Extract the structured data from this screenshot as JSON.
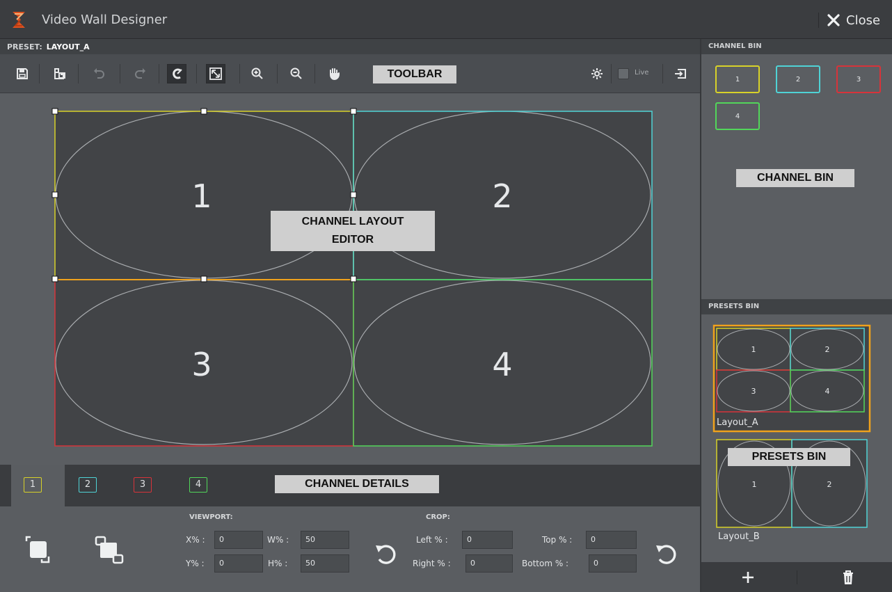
{
  "titlebar": {
    "title": "Video Wall Designer",
    "close_label": "Close"
  },
  "preset": {
    "label": "PRESET:",
    "value": "LAYOUT_A"
  },
  "toolbar": {
    "callout": "TOOLBAR",
    "live_label": "Live",
    "icons": [
      "save-icon",
      "save-as-icon",
      "undo-icon",
      "redo-icon",
      "snap-icon",
      "fit-icon",
      "zoom-in-icon",
      "zoom-out-icon",
      "pan-icon",
      "settings-icon",
      "live-checkbox",
      "export-icon"
    ]
  },
  "editor": {
    "callout_line1": "CHANNEL LAYOUT",
    "callout_line2": "EDITOR",
    "channels": [
      {
        "number": "1",
        "color": "#d8d229"
      },
      {
        "number": "2",
        "color": "#4fd3d6"
      },
      {
        "number": "3",
        "color": "#d8333a"
      },
      {
        "number": "4",
        "color": "#52d65a"
      }
    ],
    "selection_color": "#f0a21c"
  },
  "details": {
    "callout": "CHANNEL DETAILS",
    "tabs": [
      {
        "label": "1",
        "color": "#d8d229"
      },
      {
        "label": "2",
        "color": "#4fd3d6"
      },
      {
        "label": "3",
        "color": "#d8333a"
      },
      {
        "label": "4",
        "color": "#52d65a"
      }
    ],
    "viewport_label": "VIEWPORT:",
    "crop_label": "CROP:",
    "x_label": "X% :",
    "x_value": "0",
    "w_label": "W% :",
    "w_value": "50",
    "y_label": "Y% :",
    "y_value": "0",
    "h_label": "H% :",
    "h_value": "50",
    "left_label": "Left % :",
    "left_value": "0",
    "top_label": "Top % :",
    "top_value": "0",
    "right_label": "Right % :",
    "right_value": "0",
    "bottom_label": "Bottom % :",
    "bottom_value": "0"
  },
  "channel_bin": {
    "header": "CHANNEL BIN",
    "callout": "CHANNEL BIN",
    "items": [
      {
        "label": "1",
        "color": "#d8d229"
      },
      {
        "label": "2",
        "color": "#4fd3d6"
      },
      {
        "label": "3",
        "color": "#d8333a"
      },
      {
        "label": "4",
        "color": "#52d65a"
      }
    ]
  },
  "presets_bin": {
    "header": "PRESETS BIN",
    "callout": "PRESETS BIN",
    "presets": [
      {
        "name": "Layout_A",
        "cells": [
          "1",
          "2",
          "3",
          "4"
        ]
      },
      {
        "name": "Layout_B",
        "cells": [
          "1",
          "2"
        ]
      }
    ]
  }
}
